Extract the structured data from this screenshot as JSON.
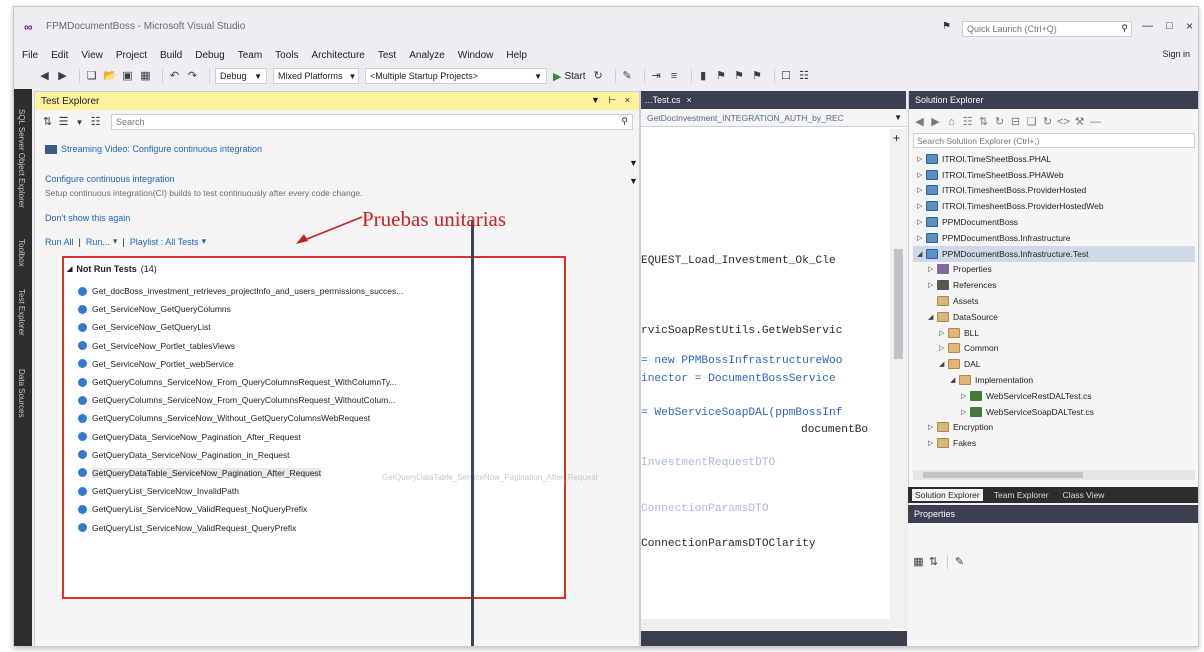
{
  "window": {
    "title": "FPMDocumentBoss - Microsoft Visual Studio",
    "quick_launch_placeholder": "Quick Launch (Ctrl+Q)",
    "sign_in": "Sign in"
  },
  "menu": [
    "File",
    "Edit",
    "View",
    "Project",
    "Build",
    "Debug",
    "Team",
    "Tools",
    "Architecture",
    "Test",
    "Analyze",
    "Window",
    "Help"
  ],
  "toolbar": {
    "configuration": "Debug",
    "platform": "Mixed Platforms",
    "startup": "<Multiple Startup Projects>",
    "start_label": "Start"
  },
  "left_strip": [
    "SQL Server Object Explorer",
    "Toolbox",
    "Test Explorer",
    "Data Sources"
  ],
  "test_explorer": {
    "title": "Test Explorer",
    "search_placeholder": "Search",
    "streaming": "Streaming Video: Configure continuous integration",
    "configure": "Configure continuous integration",
    "setup": "Setup continuous integration(CI) builds to test continuously after every code change.",
    "dont_show": "Don't show this again",
    "run_all": "Run All",
    "run": "Run...",
    "playlist": "Playlist : All Tests",
    "group_title": "Not Run Tests",
    "group_count": "(14)",
    "tests": [
      "Get_docBoss_investment_retrieves_projectInfo_and_users_permissions_succes...",
      "Get_ServiceNow_GetQueryColumns",
      "Get_ServiceNow_GetQueryList",
      "Get_ServiceNow_Portlet_tablesViews",
      "Get_ServiceNow_Portlet_webService",
      "GetQueryColumns_ServiceNow_From_QueryColumnsRequest_WithColumnTy...",
      "GetQueryColumns_ServiceNow_From_QueryColumnsRequest_WithoutColum...",
      "GetQueryColumns_ServiceNow_Without_GetQueryColumnsWebRequest",
      "GetQueryData_ServiceNow_Pagination_After_Request",
      "GetQueryData_ServiceNow_Pagination_in_Request",
      "GetQueryDataTable_ServiceNow_Pagination_After_Request",
      "GetQueryList_ServiceNow_InvalidPath",
      "GetQueryList_ServiceNow_ValidRequest_NoQueryPrefix",
      "GetQueryList_ServiceNow_ValidRequest_QueryPrefix"
    ],
    "ghost_tooltip": "GetQueryDataTable_ServiceNow_Pagination_After_Request"
  },
  "annotation": "Pruebas unitarias",
  "editor": {
    "tab": "...Test.cs",
    "nav": "GetDocInvestment_INTEGRATION_AUTH_by_REC",
    "lines": [
      "EQUEST_Load_Investment_Ok_Cle",
      "rvicSoapRestUtils.GetWebServic",
      "= new PPMBossInfrastructureWoo",
      "inector = DocumentBossService",
      "= WebServiceSoapDAL(ppmBossInf",
      "documentBo",
      "InvestmentRequestDTO",
      "ConnectionParamsDTO",
      "ConnectionParamsDTOClarity"
    ]
  },
  "solution_explorer": {
    "title": "Solution Explorer",
    "search_placeholder": "Search Solution Explorer (Ctrl+;)",
    "tree": [
      {
        "label": "ITROI.TimeSheetBoss.PHAL",
        "icon": "project",
        "caret": "right",
        "depth": 0
      },
      {
        "label": "ITROI.TimeSheetBoss.PHAWeb",
        "icon": "project",
        "caret": "right",
        "depth": 0
      },
      {
        "label": "ITROI.TimesheetBoss.ProviderHosted",
        "icon": "project",
        "caret": "right",
        "depth": 0
      },
      {
        "label": "ITROI.TimesheetBoss.ProviderHostedWeb",
        "icon": "project",
        "caret": "right",
        "depth": 0
      },
      {
        "label": "PPMDocumentBoss",
        "icon": "project",
        "caret": "right",
        "depth": 0
      },
      {
        "label": "PPMDocumentBoss.Infrastructure",
        "icon": "project",
        "caret": "right",
        "depth": 0
      },
      {
        "label": "PPMDocumentBoss.Infrastructure.Test",
        "icon": "project",
        "caret": "down",
        "depth": 0,
        "selected": true
      },
      {
        "label": "Properties",
        "icon": "props",
        "caret": "right",
        "depth": 1
      },
      {
        "label": "References",
        "icon": "refs",
        "caret": "right",
        "depth": 1
      },
      {
        "label": "Assets",
        "icon": "folder",
        "caret": "",
        "depth": 1
      },
      {
        "label": "DataSource",
        "icon": "folder",
        "caret": "down",
        "depth": 1
      },
      {
        "label": "BLL",
        "icon": "folder",
        "caret": "right",
        "depth": 2
      },
      {
        "label": "Common",
        "icon": "folder",
        "caret": "right",
        "depth": 2
      },
      {
        "label": "DAL",
        "icon": "folder",
        "caret": "down",
        "depth": 2
      },
      {
        "label": "Implementation",
        "icon": "folder",
        "caret": "down",
        "depth": 3
      },
      {
        "label": "WebServiceRestDALTest.cs",
        "icon": "cs",
        "caret": "right",
        "depth": 4
      },
      {
        "label": "WebServiceSoapDALTest.cs",
        "icon": "cs",
        "caret": "right",
        "depth": 4
      },
      {
        "label": "Encryption",
        "icon": "folder",
        "caret": "right",
        "depth": 1
      },
      {
        "label": "Fakes",
        "icon": "folder",
        "caret": "right",
        "depth": 1
      }
    ],
    "tabs": [
      "Solution Explorer",
      "Team Explorer",
      "Class View"
    ]
  },
  "properties": {
    "title": "Properties"
  },
  "colors": {
    "annotation": "#cc1f1f",
    "test_icon": "#2e7dd2",
    "te_header": "#fff29d",
    "dark_header": "#3a3f52"
  }
}
